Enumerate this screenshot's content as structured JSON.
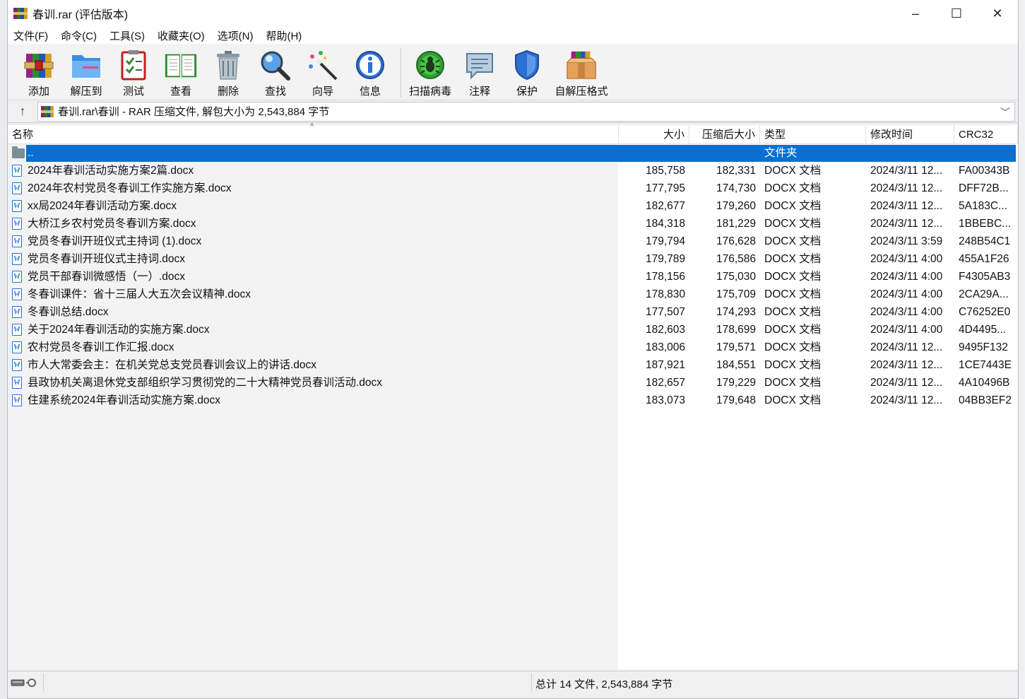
{
  "window": {
    "title": "春训.rar (评估版本)",
    "controls": {
      "minimize": "–",
      "maximize": "☐",
      "close": "✕"
    }
  },
  "menu": [
    "文件(F)",
    "命令(C)",
    "工具(S)",
    "收藏夹(O)",
    "选项(N)",
    "帮助(H)"
  ],
  "toolbar": {
    "group1": [
      {
        "label": "添加",
        "icon": "add-archive-icon"
      },
      {
        "label": "解压到",
        "icon": "extract-folder-icon"
      },
      {
        "label": "测试",
        "icon": "test-checklist-icon"
      },
      {
        "label": "查看",
        "icon": "view-book-icon"
      },
      {
        "label": "删除",
        "icon": "trash-icon"
      },
      {
        "label": "查找",
        "icon": "find-magnifier-icon"
      },
      {
        "label": "向导",
        "icon": "wizard-wand-icon"
      },
      {
        "label": "信息",
        "icon": "info-icon"
      }
    ],
    "group2": [
      {
        "label": "扫描病毒",
        "icon": "virus-scan-icon"
      },
      {
        "label": "注释",
        "icon": "comment-icon"
      },
      {
        "label": "保护",
        "icon": "shield-icon"
      },
      {
        "label": "自解压格式",
        "icon": "sfx-box-icon"
      }
    ]
  },
  "address": {
    "path": "春训.rar\\春训 - RAR 压缩文件, 解包大小为 2,543,884 字节"
  },
  "columns": {
    "name": "名称",
    "size": "大小",
    "packed": "压缩后大小",
    "type": "类型",
    "modified": "修改时间",
    "crc": "CRC32"
  },
  "parent_row": {
    "name": "..",
    "type": "文件夹"
  },
  "files": [
    {
      "name": "2024年春训活动实施方案2篇.docx",
      "size": "185,758",
      "packed": "182,331",
      "type": "DOCX 文档",
      "modified": "2024/3/11 12...",
      "crc": "FA00343B"
    },
    {
      "name": "2024年农村党员冬春训工作实施方案.docx",
      "size": "177,795",
      "packed": "174,730",
      "type": "DOCX 文档",
      "modified": "2024/3/11 12...",
      "crc": "DFF72B..."
    },
    {
      "name": "xx局2024年春训活动方案.docx",
      "size": "182,677",
      "packed": "179,260",
      "type": "DOCX 文档",
      "modified": "2024/3/11 12...",
      "crc": "5A183C..."
    },
    {
      "name": "大桥江乡农村党员冬春训方案.docx",
      "size": "184,318",
      "packed": "181,229",
      "type": "DOCX 文档",
      "modified": "2024/3/11 12...",
      "crc": "1BBEBC..."
    },
    {
      "name": "党员冬春训开班仪式主持词 (1).docx",
      "size": "179,794",
      "packed": "176,628",
      "type": "DOCX 文档",
      "modified": "2024/3/11 3:59",
      "crc": "248B54C1"
    },
    {
      "name": "党员冬春训开班仪式主持词.docx",
      "size": "179,789",
      "packed": "176,586",
      "type": "DOCX 文档",
      "modified": "2024/3/11 4:00",
      "crc": "455A1F26"
    },
    {
      "name": "党员干部春训微感悟（一）.docx",
      "size": "178,156",
      "packed": "175,030",
      "type": "DOCX 文档",
      "modified": "2024/3/11 4:00",
      "crc": "F4305AB3"
    },
    {
      "name": "冬春训课件：省十三届人大五次会议精神.docx",
      "size": "178,830",
      "packed": "175,709",
      "type": "DOCX 文档",
      "modified": "2024/3/11 4:00",
      "crc": "2CA29A..."
    },
    {
      "name": "冬春训总结.docx",
      "size": "177,507",
      "packed": "174,293",
      "type": "DOCX 文档",
      "modified": "2024/3/11 4:00",
      "crc": "C76252E0"
    },
    {
      "name": "关于2024年春训活动的实施方案.docx",
      "size": "182,603",
      "packed": "178,699",
      "type": "DOCX 文档",
      "modified": "2024/3/11 4:00",
      "crc": "4D4495..."
    },
    {
      "name": "农村党员冬春训工作汇报.docx",
      "size": "183,006",
      "packed": "179,571",
      "type": "DOCX 文档",
      "modified": "2024/3/11 12...",
      "crc": "9495F132"
    },
    {
      "name": "市人大常委会主：在机关党总支党员春训会议上的讲话.docx",
      "size": "187,921",
      "packed": "184,551",
      "type": "DOCX 文档",
      "modified": "2024/3/11 12...",
      "crc": "1CE7443E"
    },
    {
      "name": "县政协机关离退休党支部组织学习贯彻党的二十大精神党员春训活动.docx",
      "size": "182,657",
      "packed": "179,229",
      "type": "DOCX 文档",
      "modified": "2024/3/11 12...",
      "crc": "4A10496B"
    },
    {
      "name": "住建系统2024年春训活动实施方案.docx",
      "size": "183,073",
      "packed": "179,648",
      "type": "DOCX 文档",
      "modified": "2024/3/11 12...",
      "crc": "04BB3EF2"
    }
  ],
  "status": {
    "summary": "总计 14 文件, 2,543,884 字节"
  },
  "colors": {
    "selection": "#0a6fd0",
    "docx_icon": "#2b6fd1"
  }
}
